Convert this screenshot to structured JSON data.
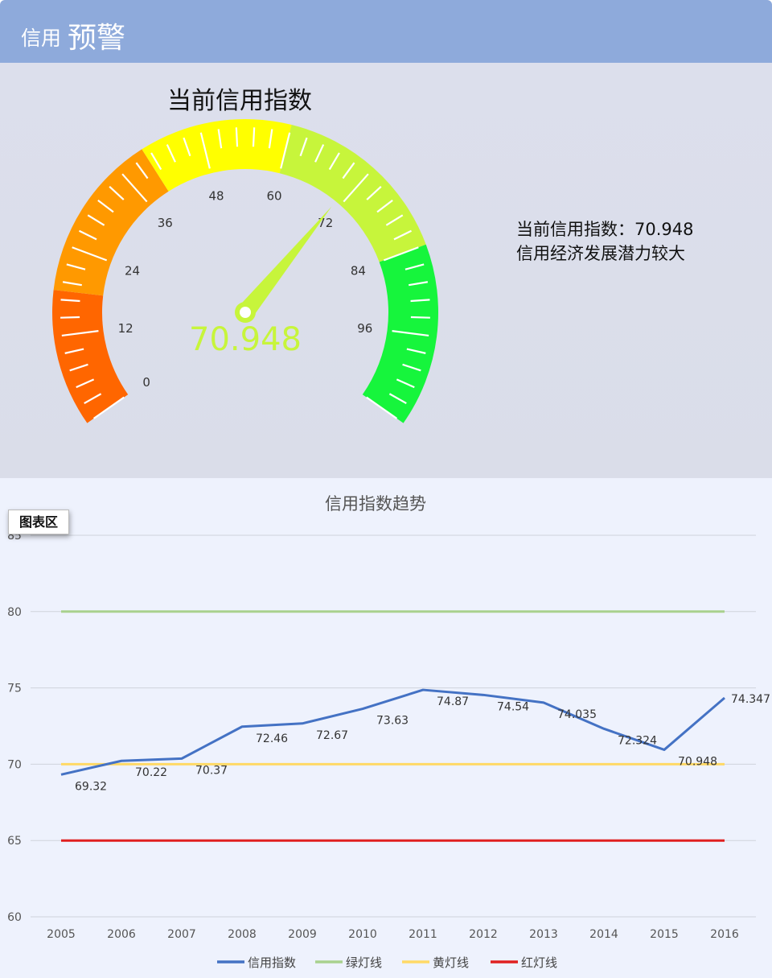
{
  "header": {
    "title_small": "信用",
    "title_large": "预警"
  },
  "gauge": {
    "title": "当前信用指数",
    "value": 70.948,
    "value_text": "70.948",
    "min": 0,
    "max": 108,
    "ticks": [
      "0",
      "12",
      "24",
      "36",
      "48",
      "60",
      "72",
      "84",
      "96"
    ],
    "bands": [
      {
        "from": 0,
        "to": 18,
        "color": "#ff6600"
      },
      {
        "from": 18,
        "to": 40,
        "color": "#ff9900"
      },
      {
        "from": 40,
        "to": 60,
        "color": "#ffff00"
      },
      {
        "from": 60,
        "to": 84,
        "color": "#c7f53b"
      },
      {
        "from": 84,
        "to": 108,
        "color": "#16f53c"
      }
    ],
    "needle_color": "#c7f53b"
  },
  "info": {
    "line1": "当前信用指数：70.948",
    "line2": "信用经济发展潜力较大"
  },
  "chart": {
    "title": "信用指数趋势",
    "area_tag": "图表区"
  },
  "chart_data": {
    "type": "line",
    "categories": [
      "2005",
      "2006",
      "2007",
      "2008",
      "2009",
      "2010",
      "2011",
      "2012",
      "2013",
      "2014",
      "2015",
      "2016"
    ],
    "ylim": [
      60,
      85
    ],
    "yticks": [
      "60",
      "65",
      "70",
      "75",
      "80",
      "85"
    ],
    "grid": true,
    "legend_position": "bottom",
    "series": [
      {
        "name": "信用指数",
        "color": "#4472c4",
        "values": [
          69.32,
          70.22,
          70.37,
          72.46,
          72.67,
          73.63,
          74.87,
          74.54,
          74.035,
          72.324,
          70.948,
          74.347
        ],
        "labels": [
          "69.32",
          "70.22",
          "70.37",
          "72.46",
          "72.67",
          "73.63",
          "74.87",
          "74.54",
          "74.035",
          "72.324",
          "70.948",
          "74.347"
        ]
      },
      {
        "name": "绿灯线",
        "color": "#a9d18e",
        "values": [
          80,
          80,
          80,
          80,
          80,
          80,
          80,
          80,
          80,
          80,
          80,
          80
        ]
      },
      {
        "name": "黄灯线",
        "color": "#ffd966",
        "values": [
          70,
          70,
          70,
          70,
          70,
          70,
          70,
          70,
          70,
          70,
          70,
          70
        ]
      },
      {
        "name": "红灯线",
        "color": "#e02020",
        "values": [
          65,
          65,
          65,
          65,
          65,
          65,
          65,
          65,
          65,
          65,
          65,
          65
        ]
      }
    ]
  }
}
